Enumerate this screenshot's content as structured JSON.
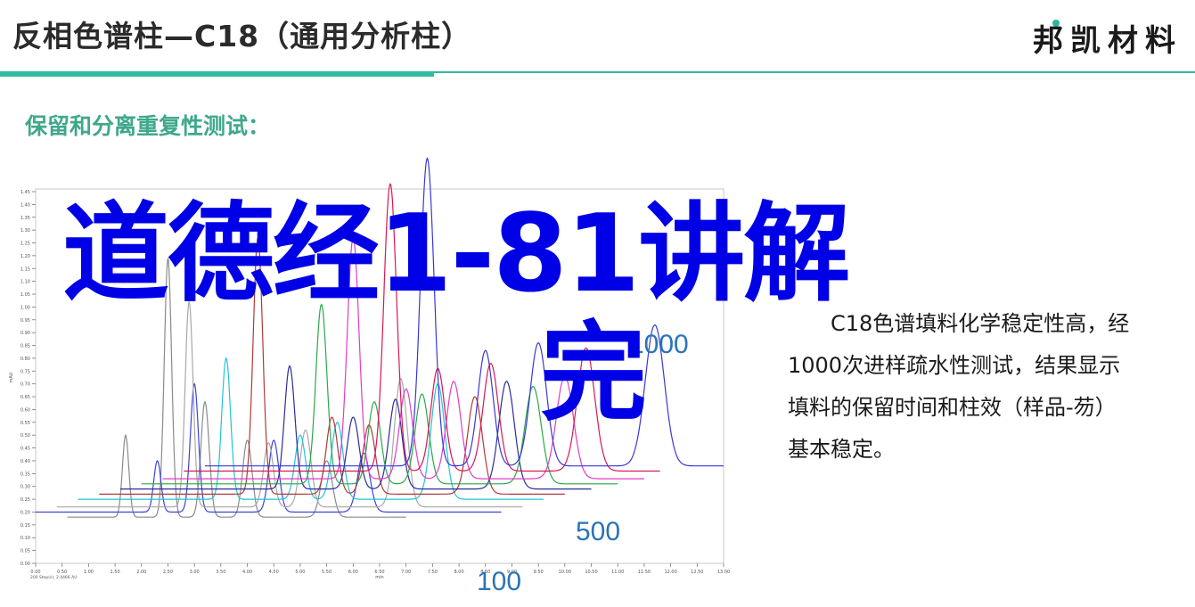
{
  "header": {
    "title": "反相色谱柱—C18（通用分析柱）",
    "brand": "邦凯材料"
  },
  "section": {
    "subtitle": "保留和分离重复性测试："
  },
  "description": "C18色谱填料化学稳定性高，经1000次进样疏水性测试，结果显示填料的保留时间和柱效（样品-芴）基本稳定。",
  "overlay": {
    "line1": "道德经1-81讲解",
    "line2": "完"
  },
  "chart_data": {
    "type": "line",
    "title": "",
    "xlabel": "min",
    "ylabel": "mAU",
    "footer": "200 Step(s), 2.4466 AU",
    "xlim": [
      0,
      13
    ],
    "x_ticks": [
      "0.00",
      "0.50",
      "1.00",
      "1.50",
      "2.00",
      "2.50",
      "3.00",
      "3.50",
      "4.00",
      "4.50",
      "5.00",
      "5.50",
      "6.00",
      "6.50",
      "7.00",
      "7.50",
      "8.00",
      "8.50",
      "9.00",
      "9.50",
      "10.00",
      "10.50",
      "11.00",
      "11.50",
      "12.00",
      "12.50",
      "13.00"
    ],
    "y_ticks": [
      "0.00",
      "0.05",
      "0.10",
      "0.15",
      "0.20",
      "0.25",
      "0.30",
      "0.35",
      "0.40",
      "0.45",
      "0.50",
      "0.55",
      "0.60",
      "0.65",
      "0.70",
      "0.75",
      "0.80",
      "0.85",
      "0.90",
      "0.95",
      "1.00",
      "1.05",
      "1.10",
      "1.15",
      "1.20",
      "1.25",
      "1.30",
      "1.35",
      "1.40",
      "1.45"
    ],
    "annotations": [
      "1000",
      "500",
      "100"
    ],
    "series": [
      {
        "name": "",
        "color": "#8a8a8a",
        "baseline": 0.18,
        "x_start": 0.6,
        "x_end": 7.0,
        "peaks": [
          {
            "x": 1.7,
            "h": 0.32
          },
          {
            "x": 2.5,
            "h": 1.01
          },
          {
            "x": 3.2,
            "h": 0.45
          },
          {
            "x": 4.0,
            "h": 0.3
          },
          {
            "x": 5.5,
            "h": 0.22
          }
        ]
      },
      {
        "name": "",
        "color": "#3a44d8",
        "baseline": 0.2,
        "x_start": 0.0,
        "x_end": 8.8,
        "peaks": [
          {
            "x": 2.3,
            "h": 0.2
          },
          {
            "x": 3.0,
            "h": 0.5
          },
          {
            "x": 4.5,
            "h": 0.28
          },
          {
            "x": 6.2,
            "h": 0.23
          }
        ]
      },
      {
        "name": "",
        "color": "#a8a8a8",
        "baseline": 0.22,
        "x_start": 0.4,
        "x_end": 9.2,
        "peaks": [
          {
            "x": 2.9,
            "h": 0.8
          },
          {
            "x": 4.4,
            "h": 0.25
          },
          {
            "x": 5.1,
            "h": 0.3
          },
          {
            "x": 6.9,
            "h": 0.5
          }
        ]
      },
      {
        "name": "",
        "color": "#22c4d8",
        "baseline": 0.25,
        "x_start": 0.8,
        "x_end": 9.6,
        "peaks": [
          {
            "x": 3.6,
            "h": 0.55
          },
          {
            "x": 5.0,
            "h": 0.25
          },
          {
            "x": 5.7,
            "h": 0.3
          },
          {
            "x": 7.6,
            "h": 0.45
          }
        ]
      },
      {
        "name": "",
        "color": "#b03a3a",
        "baseline": 0.27,
        "x_start": 1.2,
        "x_end": 10.0,
        "peaks": [
          {
            "x": 4.2,
            "h": 1.0
          },
          {
            "x": 5.6,
            "h": 0.3
          },
          {
            "x": 6.3,
            "h": 0.27
          },
          {
            "x": 8.3,
            "h": 0.38
          }
        ]
      },
      {
        "name": "",
        "color": "#2c2c9c",
        "baseline": 0.29,
        "x_start": 1.6,
        "x_end": 10.5,
        "peaks": [
          {
            "x": 4.8,
            "h": 0.48
          },
          {
            "x": 6.0,
            "h": 0.28
          },
          {
            "x": 6.8,
            "h": 0.35
          },
          {
            "x": 8.9,
            "h": 0.42
          }
        ]
      },
      {
        "name": "",
        "color": "#2aa84a",
        "baseline": 0.31,
        "x_start": 2.0,
        "x_end": 11.0,
        "peaks": [
          {
            "x": 5.4,
            "h": 0.7
          },
          {
            "x": 6.4,
            "h": 0.32
          },
          {
            "x": 7.3,
            "h": 0.35
          },
          {
            "x": 9.4,
            "h": 0.38
          }
        ]
      },
      {
        "name": "",
        "color": "#e03cc8",
        "baseline": 0.33,
        "x_start": 2.4,
        "x_end": 11.5,
        "peaks": [
          {
            "x": 6.0,
            "h": 0.94
          },
          {
            "x": 7.0,
            "h": 0.35
          },
          {
            "x": 7.9,
            "h": 0.38
          },
          {
            "x": 10.0,
            "h": 0.4
          }
        ]
      },
      {
        "name": "",
        "color": "#d81850",
        "baseline": 0.36,
        "x_start": 2.8,
        "x_end": 11.8,
        "peaks": [
          {
            "x": 6.7,
            "h": 1.12
          },
          {
            "x": 7.6,
            "h": 0.4
          },
          {
            "x": 8.6,
            "h": 0.42
          },
          {
            "x": 10.4,
            "h": 0.48
          }
        ]
      },
      {
        "name": "",
        "color": "#3838d8",
        "baseline": 0.38,
        "x_start": 3.2,
        "x_end": 13.0,
        "peaks": [
          {
            "x": 7.4,
            "h": 1.2
          },
          {
            "x": 8.5,
            "h": 0.45
          },
          {
            "x": 9.5,
            "h": 0.48
          },
          {
            "x": 11.7,
            "h": 0.55
          }
        ]
      }
    ]
  }
}
